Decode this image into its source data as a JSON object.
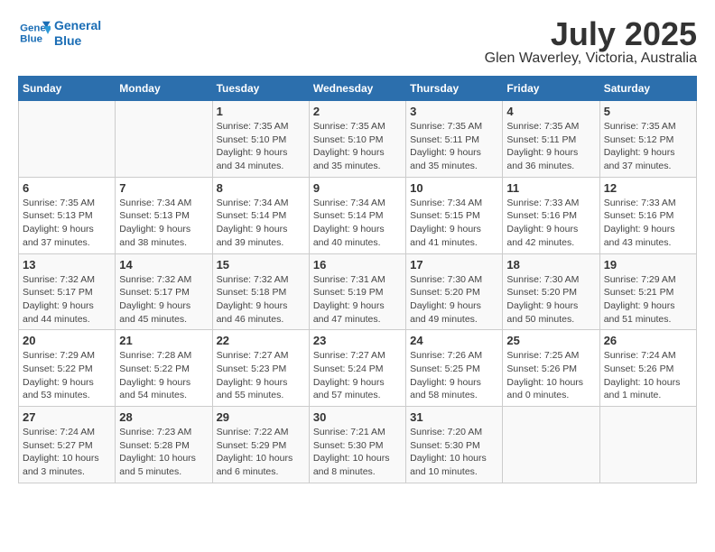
{
  "logo": {
    "line1": "General",
    "line2": "Blue"
  },
  "title": "July 2025",
  "subtitle": "Glen Waverley, Victoria, Australia",
  "days_of_week": [
    "Sunday",
    "Monday",
    "Tuesday",
    "Wednesday",
    "Thursday",
    "Friday",
    "Saturday"
  ],
  "weeks": [
    [
      {
        "day": "",
        "info": ""
      },
      {
        "day": "",
        "info": ""
      },
      {
        "day": "1",
        "info": "Sunrise: 7:35 AM\nSunset: 5:10 PM\nDaylight: 9 hours\nand 34 minutes."
      },
      {
        "day": "2",
        "info": "Sunrise: 7:35 AM\nSunset: 5:10 PM\nDaylight: 9 hours\nand 35 minutes."
      },
      {
        "day": "3",
        "info": "Sunrise: 7:35 AM\nSunset: 5:11 PM\nDaylight: 9 hours\nand 35 minutes."
      },
      {
        "day": "4",
        "info": "Sunrise: 7:35 AM\nSunset: 5:11 PM\nDaylight: 9 hours\nand 36 minutes."
      },
      {
        "day": "5",
        "info": "Sunrise: 7:35 AM\nSunset: 5:12 PM\nDaylight: 9 hours\nand 37 minutes."
      }
    ],
    [
      {
        "day": "6",
        "info": "Sunrise: 7:35 AM\nSunset: 5:13 PM\nDaylight: 9 hours\nand 37 minutes."
      },
      {
        "day": "7",
        "info": "Sunrise: 7:34 AM\nSunset: 5:13 PM\nDaylight: 9 hours\nand 38 minutes."
      },
      {
        "day": "8",
        "info": "Sunrise: 7:34 AM\nSunset: 5:14 PM\nDaylight: 9 hours\nand 39 minutes."
      },
      {
        "day": "9",
        "info": "Sunrise: 7:34 AM\nSunset: 5:14 PM\nDaylight: 9 hours\nand 40 minutes."
      },
      {
        "day": "10",
        "info": "Sunrise: 7:34 AM\nSunset: 5:15 PM\nDaylight: 9 hours\nand 41 minutes."
      },
      {
        "day": "11",
        "info": "Sunrise: 7:33 AM\nSunset: 5:16 PM\nDaylight: 9 hours\nand 42 minutes."
      },
      {
        "day": "12",
        "info": "Sunrise: 7:33 AM\nSunset: 5:16 PM\nDaylight: 9 hours\nand 43 minutes."
      }
    ],
    [
      {
        "day": "13",
        "info": "Sunrise: 7:32 AM\nSunset: 5:17 PM\nDaylight: 9 hours\nand 44 minutes."
      },
      {
        "day": "14",
        "info": "Sunrise: 7:32 AM\nSunset: 5:17 PM\nDaylight: 9 hours\nand 45 minutes."
      },
      {
        "day": "15",
        "info": "Sunrise: 7:32 AM\nSunset: 5:18 PM\nDaylight: 9 hours\nand 46 minutes."
      },
      {
        "day": "16",
        "info": "Sunrise: 7:31 AM\nSunset: 5:19 PM\nDaylight: 9 hours\nand 47 minutes."
      },
      {
        "day": "17",
        "info": "Sunrise: 7:30 AM\nSunset: 5:20 PM\nDaylight: 9 hours\nand 49 minutes."
      },
      {
        "day": "18",
        "info": "Sunrise: 7:30 AM\nSunset: 5:20 PM\nDaylight: 9 hours\nand 50 minutes."
      },
      {
        "day": "19",
        "info": "Sunrise: 7:29 AM\nSunset: 5:21 PM\nDaylight: 9 hours\nand 51 minutes."
      }
    ],
    [
      {
        "day": "20",
        "info": "Sunrise: 7:29 AM\nSunset: 5:22 PM\nDaylight: 9 hours\nand 53 minutes."
      },
      {
        "day": "21",
        "info": "Sunrise: 7:28 AM\nSunset: 5:22 PM\nDaylight: 9 hours\nand 54 minutes."
      },
      {
        "day": "22",
        "info": "Sunrise: 7:27 AM\nSunset: 5:23 PM\nDaylight: 9 hours\nand 55 minutes."
      },
      {
        "day": "23",
        "info": "Sunrise: 7:27 AM\nSunset: 5:24 PM\nDaylight: 9 hours\nand 57 minutes."
      },
      {
        "day": "24",
        "info": "Sunrise: 7:26 AM\nSunset: 5:25 PM\nDaylight: 9 hours\nand 58 minutes."
      },
      {
        "day": "25",
        "info": "Sunrise: 7:25 AM\nSunset: 5:26 PM\nDaylight: 10 hours\nand 0 minutes."
      },
      {
        "day": "26",
        "info": "Sunrise: 7:24 AM\nSunset: 5:26 PM\nDaylight: 10 hours\nand 1 minute."
      }
    ],
    [
      {
        "day": "27",
        "info": "Sunrise: 7:24 AM\nSunset: 5:27 PM\nDaylight: 10 hours\nand 3 minutes."
      },
      {
        "day": "28",
        "info": "Sunrise: 7:23 AM\nSunset: 5:28 PM\nDaylight: 10 hours\nand 5 minutes."
      },
      {
        "day": "29",
        "info": "Sunrise: 7:22 AM\nSunset: 5:29 PM\nDaylight: 10 hours\nand 6 minutes."
      },
      {
        "day": "30",
        "info": "Sunrise: 7:21 AM\nSunset: 5:30 PM\nDaylight: 10 hours\nand 8 minutes."
      },
      {
        "day": "31",
        "info": "Sunrise: 7:20 AM\nSunset: 5:30 PM\nDaylight: 10 hours\nand 10 minutes."
      },
      {
        "day": "",
        "info": ""
      },
      {
        "day": "",
        "info": ""
      }
    ]
  ]
}
